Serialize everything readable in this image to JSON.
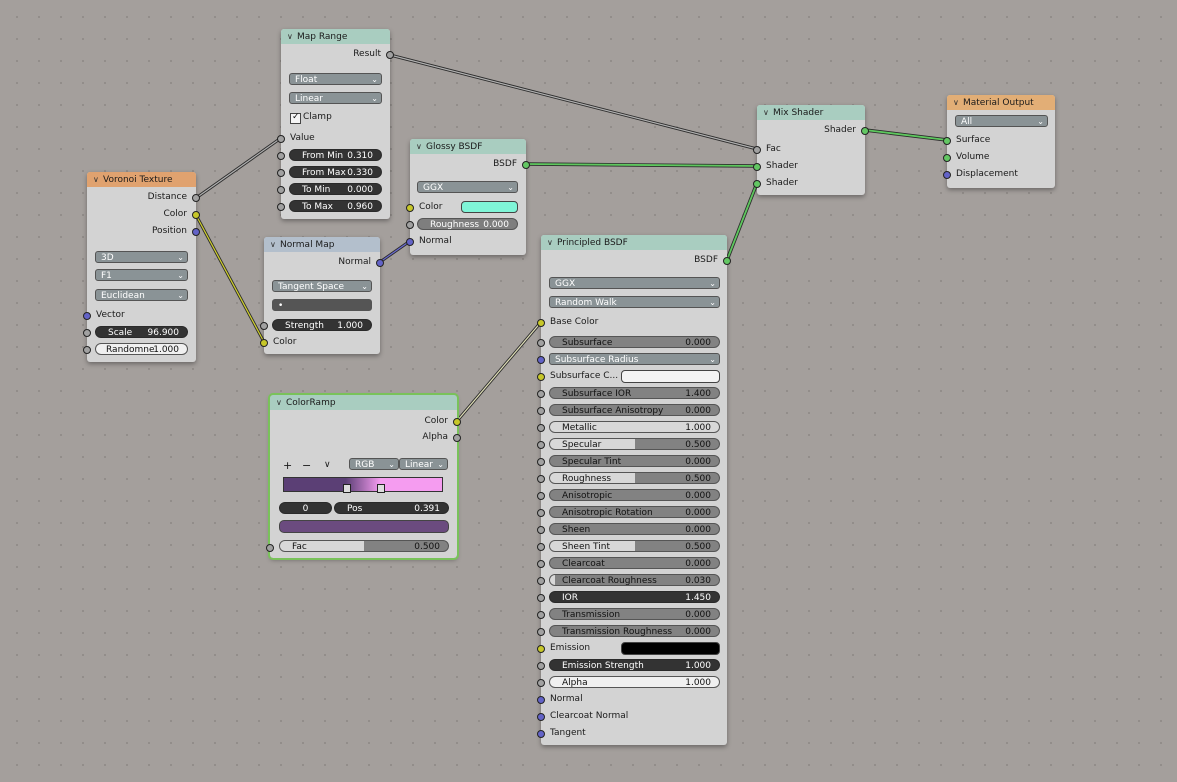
{
  "colors": {
    "background": "#a49f9c",
    "node_body": "#d3d3d3",
    "header_texture": "#e0a26f",
    "header_converter": "#a9cdc0",
    "header_vector": "#b3bfcc",
    "header_output": "#e2ae76",
    "socket_float": "#a1a1a1",
    "socket_color": "#c7c729",
    "socket_vector": "#6363c7",
    "socket_shader": "#63c763",
    "selected_outline": "#79c25a"
  },
  "voronoi": {
    "title": "Voronoi Texture",
    "out_distance": "Distance",
    "out_color": "Color",
    "out_position": "Position",
    "dim": "3D",
    "feature": "F1",
    "metric": "Euclidean",
    "in_vector": "Vector",
    "scale_label": "Scale",
    "scale_value": "96.900",
    "random_label": "Randomne",
    "random_value": "1.000"
  },
  "map_range": {
    "title": "Map Range",
    "out_result": "Result",
    "data_type": "Float",
    "interp": "Linear",
    "clamp_label": "Clamp",
    "clamp_checked": true,
    "in_value": "Value",
    "from_min_label": "From Min",
    "from_min_value": "0.310",
    "from_max_label": "From Max",
    "from_max_value": "0.330",
    "to_min_label": "To Min",
    "to_min_value": "0.000",
    "to_max_label": "To Max",
    "to_max_value": "0.960"
  },
  "normal_map": {
    "title": "Normal Map",
    "out_normal": "Normal",
    "space": "Tangent Space",
    "uv": "•",
    "strength_label": "Strength",
    "strength_value": "1.000",
    "in_color": "Color"
  },
  "glossy": {
    "title": "Glossy BSDF",
    "out_bsdf": "BSDF",
    "distribution": "GGX",
    "color_label": "Color",
    "color_swatch": "#7ff5d7",
    "roughness_label": "Roughness",
    "roughness_value": "0.000",
    "in_normal": "Normal"
  },
  "colorramp": {
    "title": "ColorRamp",
    "out_color": "Color",
    "out_alpha": "Alpha",
    "add": "+",
    "remove": "−",
    "more": "∨",
    "mode": "RGB",
    "interp": "Linear",
    "ramp_left_color": "#5b3f75",
    "ramp_right_color": "#f59cf0",
    "stop_index": "0",
    "pos_label": "Pos",
    "pos_value": "0.391",
    "stop_color": "#6b4b7f",
    "fac_label": "Fac",
    "fac_value": "0.500",
    "fac_fraction": 0.5
  },
  "principled": {
    "title": "Principled BSDF",
    "out_bsdf": "BSDF",
    "distribution": "GGX",
    "subsurface_method": "Random Walk",
    "base_color": "Base Color",
    "subsurface_label": "Subsurface",
    "subsurface_value": "0.000",
    "subsurface_radius": "Subsurface Radius",
    "subsurface_color": "Subsurface C...",
    "ssior_label": "Subsurface IOR",
    "ssior_value": "1.400",
    "ssaniso_label": "Subsurface Anisotropy",
    "ssaniso_value": "0.000",
    "metallic_label": "Metallic",
    "metallic_value": "1.000",
    "specular_label": "Specular",
    "specular_value": "0.500",
    "spectint_label": "Specular Tint",
    "spectint_value": "0.000",
    "roughness_label": "Roughness",
    "roughness_value": "0.500",
    "aniso_label": "Anisotropic",
    "aniso_value": "0.000",
    "anisorot_label": "Anisotropic Rotation",
    "anisorot_value": "0.000",
    "sheen_label": "Sheen",
    "sheen_value": "0.000",
    "sheentint_label": "Sheen Tint",
    "sheentint_value": "0.500",
    "clearcoat_label": "Clearcoat",
    "clearcoat_value": "0.000",
    "ccrough_label": "Clearcoat Roughness",
    "ccrough_value": "0.030",
    "ior_label": "IOR",
    "ior_value": "1.450",
    "trans_label": "Transmission",
    "trans_value": "0.000",
    "transrough_label": "Transmission Roughness",
    "transrough_value": "0.000",
    "emission": "Emission",
    "emission_color": "#000000",
    "emstrength_label": "Emission Strength",
    "emstrength_value": "1.000",
    "alpha_label": "Alpha",
    "alpha_value": "1.000",
    "normal": "Normal",
    "cc_normal": "Clearcoat Normal",
    "tangent": "Tangent",
    "fractions": {
      "subsurface": 0,
      "ssior": 0,
      "ssaniso": 0,
      "metallic": 1,
      "specular": 0.5,
      "spectint": 0,
      "roughness": 0.5,
      "aniso": 0,
      "anisorot": 0,
      "sheen": 0,
      "sheentint": 0.5,
      "clearcoat": 0,
      "ccrough": 0.03,
      "trans": 0,
      "transrough": 0
    }
  },
  "mix": {
    "title": "Mix Shader",
    "out_shader": "Shader",
    "in_fac": "Fac",
    "in_shader1": "Shader",
    "in_shader2": "Shader"
  },
  "output": {
    "title": "Material Output",
    "target": "All",
    "in_surface": "Surface",
    "in_volume": "Volume",
    "in_displacement": "Displacement"
  }
}
